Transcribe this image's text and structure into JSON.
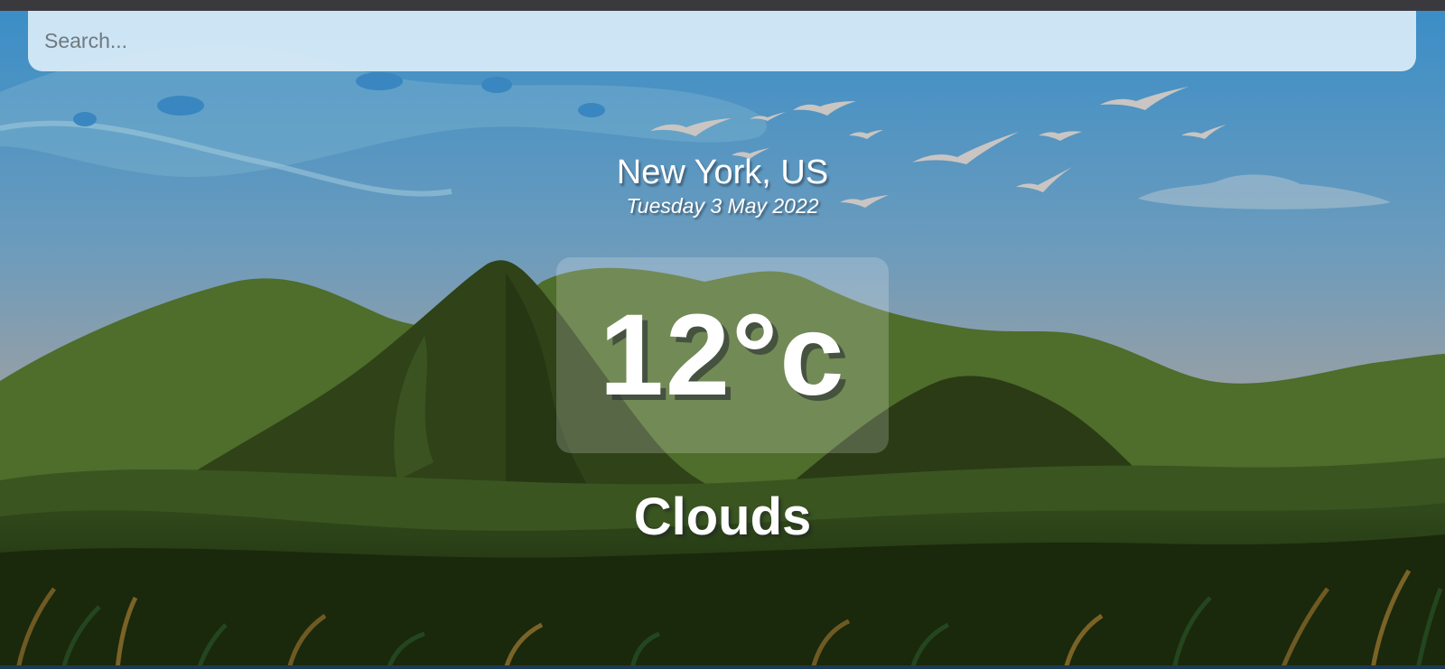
{
  "search": {
    "placeholder": "Search...",
    "value": ""
  },
  "location": {
    "city": "New York, US",
    "date": "Tuesday 3 May 2022"
  },
  "weather": {
    "temperature": "12°c",
    "condition": "Clouds"
  },
  "colors": {
    "sky_top": "#3b8ec7",
    "sky_bottom": "#8f9496",
    "hills": "#4d6b2a",
    "search_bg": "#d9ecf7",
    "text": "#ffffff"
  },
  "icons": [
    "bird-icon",
    "cloud-icon"
  ]
}
